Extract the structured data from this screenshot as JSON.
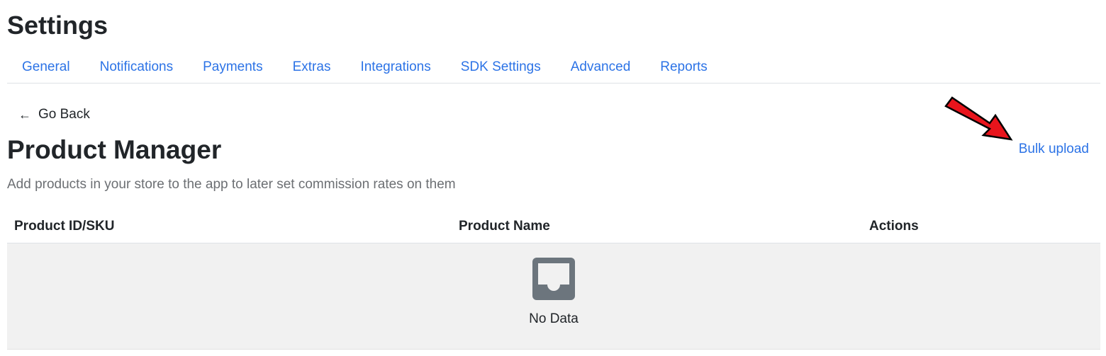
{
  "header": {
    "title": "Settings"
  },
  "tabs": [
    {
      "label": "General"
    },
    {
      "label": "Notifications"
    },
    {
      "label": "Payments"
    },
    {
      "label": "Extras"
    },
    {
      "label": "Integrations"
    },
    {
      "label": "SDK Settings"
    },
    {
      "label": "Advanced"
    },
    {
      "label": "Reports"
    }
  ],
  "back": {
    "icon": "arrow-left-icon",
    "label": "Go Back"
  },
  "main": {
    "title": "Product Manager",
    "subtitle": "Add products in your store to the app to later set commission rates on them",
    "bulk_upload_label": "Bulk upload"
  },
  "table": {
    "columns": [
      "Product ID/SKU",
      "Product Name",
      "Actions"
    ],
    "rows": [],
    "empty_icon": "inbox-icon",
    "empty_text": "No Data"
  },
  "colors": {
    "link": "#2c73e6",
    "annotation_arrow": "#e8141c",
    "empty_background": "#f1f1f1",
    "icon_gray": "#6c757d"
  }
}
